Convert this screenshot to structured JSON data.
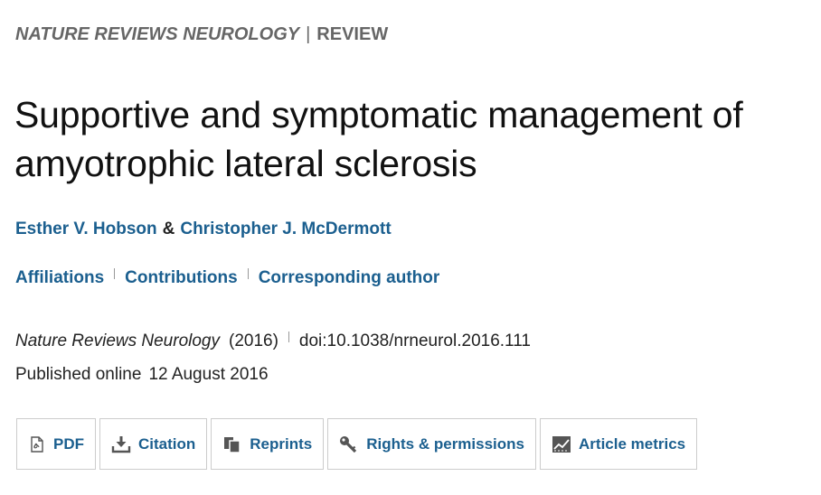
{
  "header": {
    "journal": "NATURE REVIEWS NEUROLOGY",
    "separator": "|",
    "article_type": "REVIEW"
  },
  "article": {
    "title": "Supportive and symptomatic management of amyotrophic lateral sclerosis",
    "authors": [
      {
        "name": "Esther V. Hobson"
      },
      {
        "name": "Christopher J. McDermott"
      }
    ],
    "author_joiner": "&",
    "meta_links": {
      "affiliations": "Affiliations",
      "contributions": "Contributions",
      "corresponding_author": "Corresponding author"
    },
    "citation": {
      "journal": "Nature Reviews Neurology",
      "year": "(2016)",
      "doi": "doi:10.1038/nrneurol.2016.111"
    },
    "published": {
      "label": "Published online",
      "date": "12 August 2016"
    }
  },
  "toolbar": {
    "buttons": [
      {
        "label": "PDF",
        "icon": "pdf-icon"
      },
      {
        "label": "Citation",
        "icon": "download-icon"
      },
      {
        "label": "Reprints",
        "icon": "reprints-icon"
      },
      {
        "label": "Rights & permissions",
        "icon": "key-icon"
      },
      {
        "label": "Article metrics",
        "icon": "metrics-icon"
      }
    ]
  },
  "colors": {
    "link": "#1b5f8f",
    "header_text": "#666666",
    "body_text": "#222222",
    "border": "#cccccc"
  }
}
